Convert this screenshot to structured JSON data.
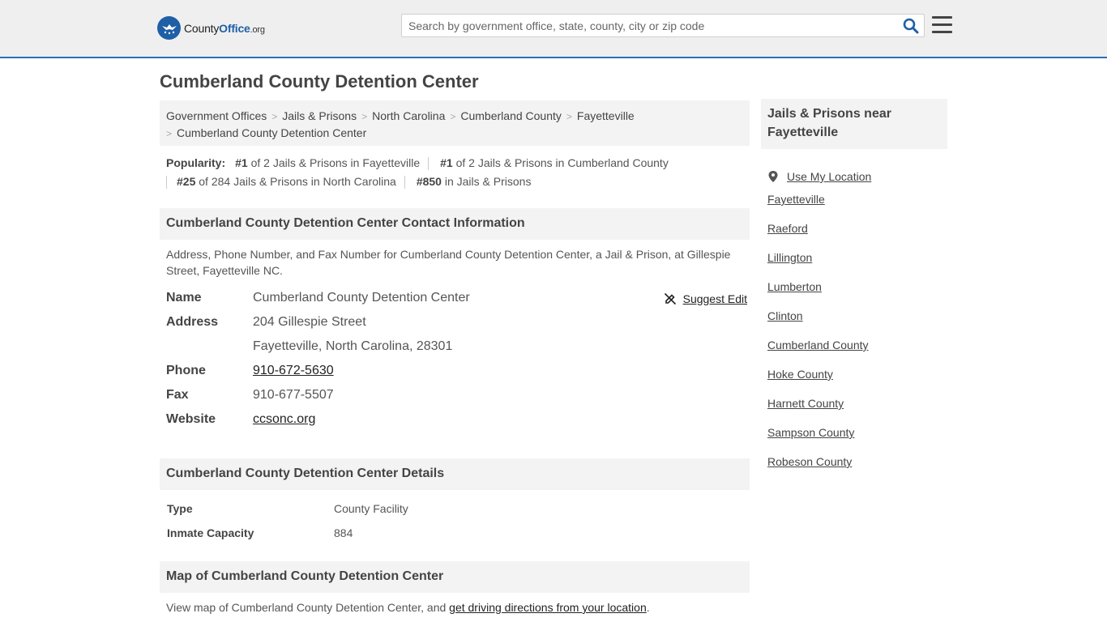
{
  "header": {
    "logo_text_county": "County",
    "logo_text_office": "Office",
    "logo_text_org": ".org",
    "search_placeholder": "Search by government office, state, county, city or zip code",
    "accent_color": "#2a70b8"
  },
  "page": {
    "title": "Cumberland County Detention Center"
  },
  "breadcrumb": {
    "items": [
      "Government Offices",
      "Jails & Prisons",
      "North Carolina",
      "Cumberland County",
      "Fayetteville",
      "Cumberland County Detention Center"
    ]
  },
  "popularity": {
    "label": "Popularity:",
    "items": [
      {
        "rank": "#1",
        "text": " of 2 Jails & Prisons in Fayetteville"
      },
      {
        "rank": "#1",
        "text": " of 2 Jails & Prisons in Cumberland County"
      },
      {
        "rank": "#25",
        "text": " of 284 Jails & Prisons in North Carolina"
      },
      {
        "rank": "#850",
        "text": " in Jails & Prisons"
      }
    ]
  },
  "contact": {
    "heading": "Cumberland County Detention Center Contact Information",
    "description": "Address, Phone Number, and Fax Number for Cumberland County Detention Center, a Jail & Prison, at Gillespie Street, Fayetteville NC.",
    "suggest_edit": "Suggest Edit",
    "name_label": "Name",
    "name_value": "Cumberland County Detention Center",
    "address_label": "Address",
    "address_line1": "204 Gillespie Street",
    "address_line2": "Fayetteville, North Carolina, 28301",
    "phone_label": "Phone",
    "phone_value": "910-672-5630",
    "fax_label": "Fax",
    "fax_value": "910-677-5507",
    "website_label": "Website",
    "website_value": "ccsonc.org"
  },
  "details": {
    "heading": "Cumberland County Detention Center Details",
    "rows": [
      {
        "label": "Type",
        "value": "County Facility"
      },
      {
        "label": "Inmate Capacity",
        "value": "884"
      }
    ]
  },
  "map": {
    "heading": "Map of Cumberland County Detention Center",
    "desc_prefix": "View map of Cumberland County Detention Center, and ",
    "desc_link": "get driving directions from your location",
    "desc_suffix": "."
  },
  "sidebar": {
    "heading": "Jails & Prisons near Fayetteville",
    "use_location": "Use My Location",
    "links": [
      "Fayetteville",
      "Raeford",
      "Lillington",
      "Lumberton",
      "Clinton",
      "Cumberland County",
      "Hoke County",
      "Harnett County",
      "Sampson County",
      "Robeson County"
    ]
  }
}
